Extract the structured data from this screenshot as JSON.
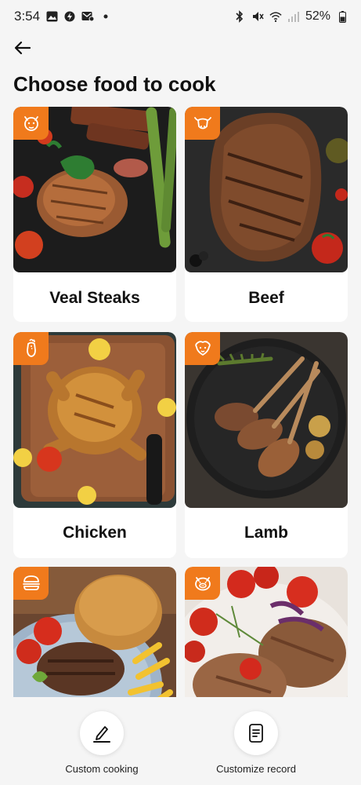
{
  "status_bar": {
    "time": "3:54",
    "battery": "52%"
  },
  "header": {
    "title": "Choose food to cook"
  },
  "foods": [
    {
      "label": "Veal Steaks",
      "icon": "veal-icon"
    },
    {
      "label": "Beef",
      "icon": "cow-icon"
    },
    {
      "label": "Chicken",
      "icon": "chicken-icon"
    },
    {
      "label": "Lamb",
      "icon": "sheep-icon"
    },
    {
      "label": "",
      "icon": "burger-icon"
    },
    {
      "label": "",
      "icon": "pig-icon"
    }
  ],
  "bottom_bar": {
    "custom_cooking": "Custom cooking",
    "customize_record": "Customize record"
  },
  "colors": {
    "accent": "#f07a1c",
    "background": "#f5f5f5",
    "card": "#ffffff"
  }
}
